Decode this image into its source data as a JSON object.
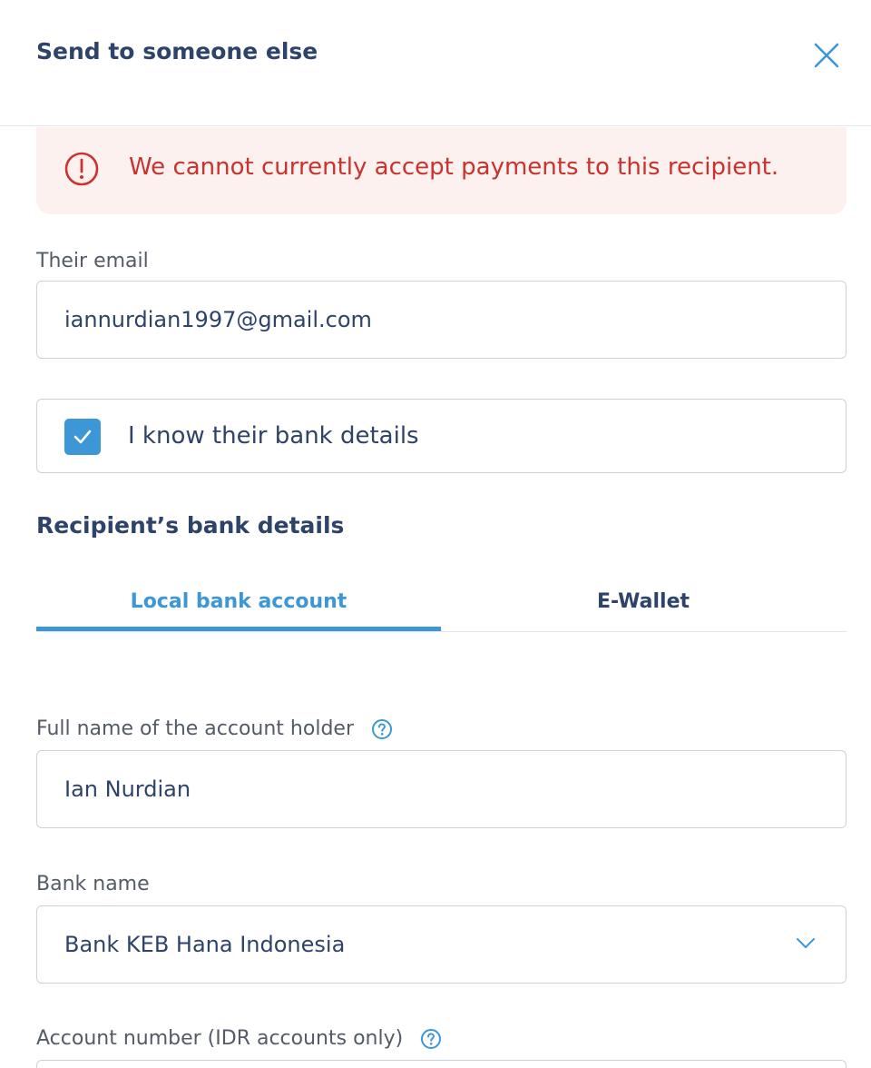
{
  "header": {
    "title": "Send to someone else"
  },
  "alert": {
    "message": "We cannot currently accept payments to this recipient."
  },
  "email": {
    "label": "Their email",
    "value": "iannurdian1997@gmail.com"
  },
  "bank_details_check": {
    "label": "I know their bank details",
    "checked": true
  },
  "recipient": {
    "section_title": "Recipient’s bank details",
    "tabs": [
      {
        "label": "Local bank account",
        "active": true
      },
      {
        "label": "E-Wallet",
        "active": false
      }
    ],
    "account_holder": {
      "label": "Full name of the account holder",
      "value": "Ian Nurdian"
    },
    "bank_name": {
      "label": "Bank name",
      "value": "Bank KEB Hana Indonesia"
    },
    "account_number": {
      "label": "Account number (IDR accounts only)",
      "value": ""
    }
  },
  "colors": {
    "accent": "#3d97d6",
    "error": "#c8332e",
    "error_bg": "#fdf1f0",
    "text": "#2e4369"
  },
  "icons": {
    "close": "close-icon",
    "alert": "exclamation-circle-icon",
    "check": "check-icon",
    "help": "question-circle-icon",
    "dropdown": "chevron-down-icon"
  }
}
